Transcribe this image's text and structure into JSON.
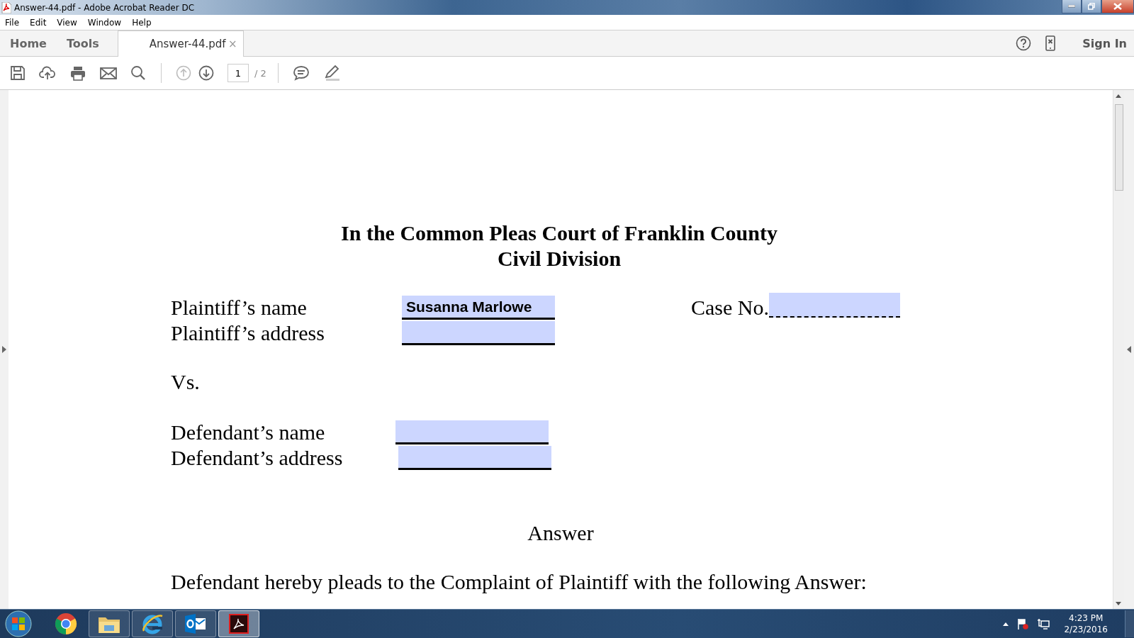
{
  "window": {
    "title": "Answer-44.pdf - Adobe Acrobat Reader DC"
  },
  "menu": [
    "File",
    "Edit",
    "View",
    "Window",
    "Help"
  ],
  "tabs": [
    {
      "label": "Home",
      "kind": "nav",
      "selected": false
    },
    {
      "label": "Tools",
      "kind": "nav",
      "selected": false
    },
    {
      "label": "Answer-44.pdf",
      "kind": "document",
      "selected": true,
      "close": "×"
    }
  ],
  "sign_in": "Sign In",
  "toolbar": {
    "page": "1",
    "page_total": "/ 2"
  },
  "document": {
    "heading": [
      "In the Common Pleas Court of Franklin County",
      "Civil Division"
    ],
    "case_label": "Case No.",
    "plaintiff": [
      {
        "label": "Plaintiff’s name",
        "value": "Susanna Marlowe"
      },
      {
        "label": "Plaintiff’s address"
      }
    ],
    "versus": "Vs.",
    "defendant": [
      {
        "label": "Defendant’s name"
      },
      {
        "label": "Defendant’s address"
      }
    ],
    "answer_title": "Answer",
    "paragraph": "Defendant hereby pleads to the Complaint of Plaintiff with the following Answer:"
  },
  "taskbar": {
    "apps": [
      {
        "kind": "chrome",
        "running": false,
        "active": false
      },
      {
        "kind": "explorer",
        "running": true,
        "active": false
      },
      {
        "kind": "ie",
        "running": true,
        "active": false
      },
      {
        "kind": "outlook",
        "running": true,
        "active": false
      },
      {
        "kind": "acrobat",
        "running": true,
        "active": true
      }
    ],
    "time": "4:23 PM",
    "date": "2/23/2016"
  }
}
